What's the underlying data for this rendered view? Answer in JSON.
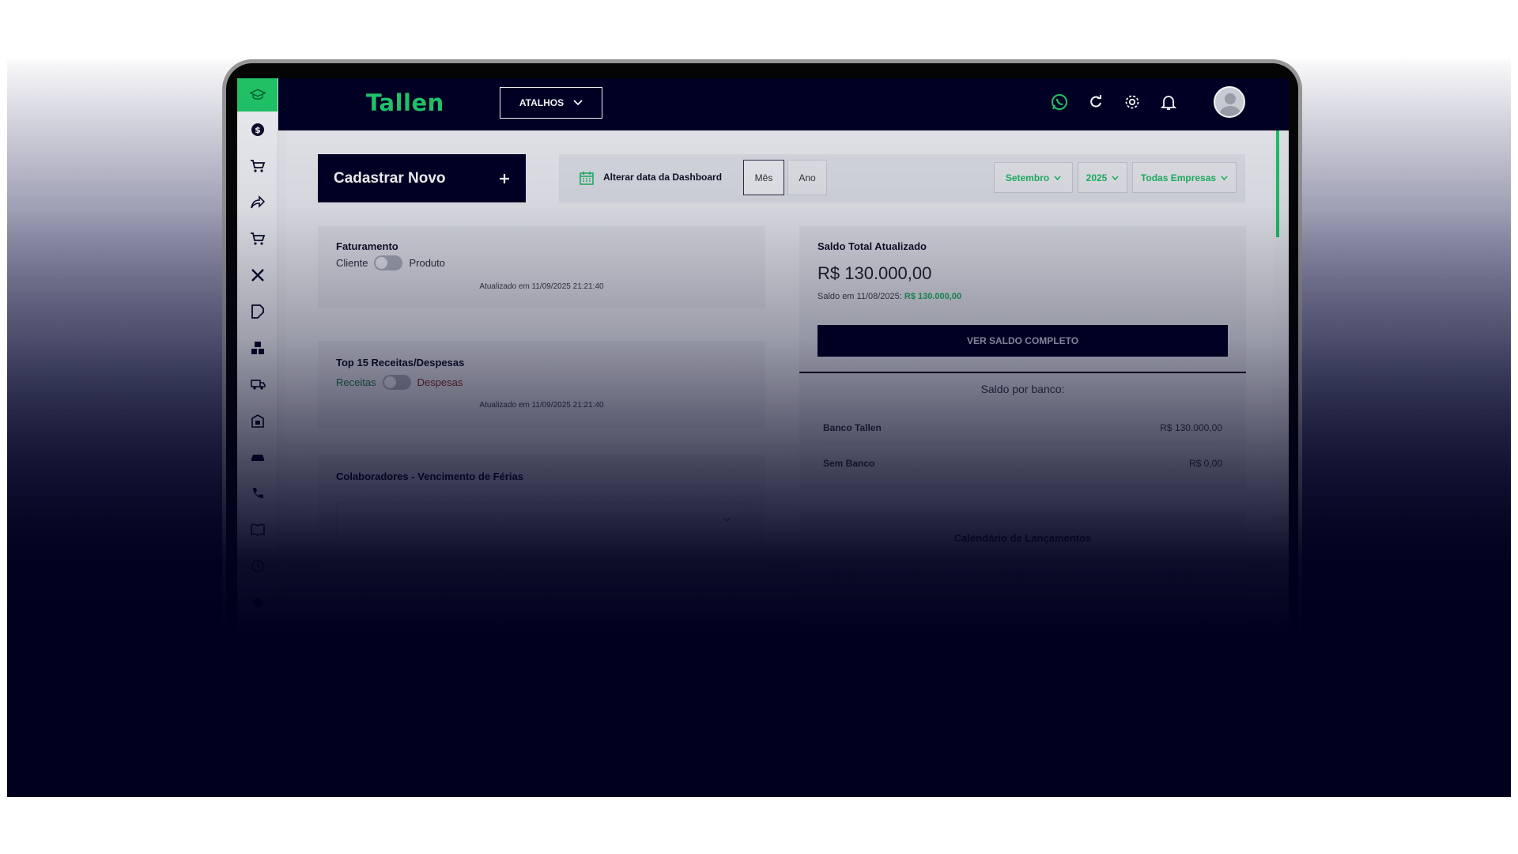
{
  "app": {
    "logo": "Tallen"
  },
  "topbar": {
    "atalhos_label": "ATALHOS"
  },
  "sidebar": {
    "items": [
      {
        "icon": "dollar-icon"
      },
      {
        "icon": "cart-icon"
      },
      {
        "icon": "share-icon"
      },
      {
        "icon": "cart-down-icon"
      },
      {
        "icon": "tools-icon"
      },
      {
        "icon": "tag-edit-icon"
      },
      {
        "icon": "boxes-icon"
      },
      {
        "icon": "truck-icon"
      },
      {
        "icon": "building-icon"
      },
      {
        "icon": "car-icon"
      },
      {
        "icon": "phone-icon"
      },
      {
        "icon": "book-icon"
      },
      {
        "icon": "clock-icon"
      },
      {
        "icon": "circle-icon"
      }
    ]
  },
  "toolbar": {
    "cadastrar_label": "Cadastrar Novo",
    "alterar_label": "Alterar data da Dashboard",
    "mes_label": "Mês",
    "ano_label": "Ano",
    "month_value": "Setembro",
    "year_value": "2025",
    "company_value": "Todas Empresas"
  },
  "faturamento": {
    "title": "Faturamento",
    "toggle_left": "Cliente",
    "toggle_right": "Produto",
    "updated": "Atualizado em 11/09/2025 21:21:40"
  },
  "top15": {
    "title": "Top 15 Receitas/Despesas",
    "toggle_left": "Receitas",
    "toggle_right": "Despesas",
    "updated": "Atualizado em 11/09/2025 21:21:40"
  },
  "colaboradores": {
    "title": "Colaboradores - Vencimento de Férias"
  },
  "saldo": {
    "title": "Saldo Total Atualizado",
    "value": "R$ 130.000,00",
    "saldo_em_label": "Saldo em 11/08/2025:",
    "saldo_em_value": "R$ 130.000,00",
    "ver_label": "VER SALDO COMPLETO",
    "por_banco_label": "Saldo por banco:",
    "banks": [
      {
        "name": "Banco Tallen",
        "value": "R$ 130.000,00"
      },
      {
        "name": "Sem Banco",
        "value": "R$ 0,00"
      }
    ]
  },
  "calendario": {
    "title": "Calendário de Lançamentos"
  },
  "colors": {
    "accent": "#21c768",
    "navy": "#000025"
  }
}
